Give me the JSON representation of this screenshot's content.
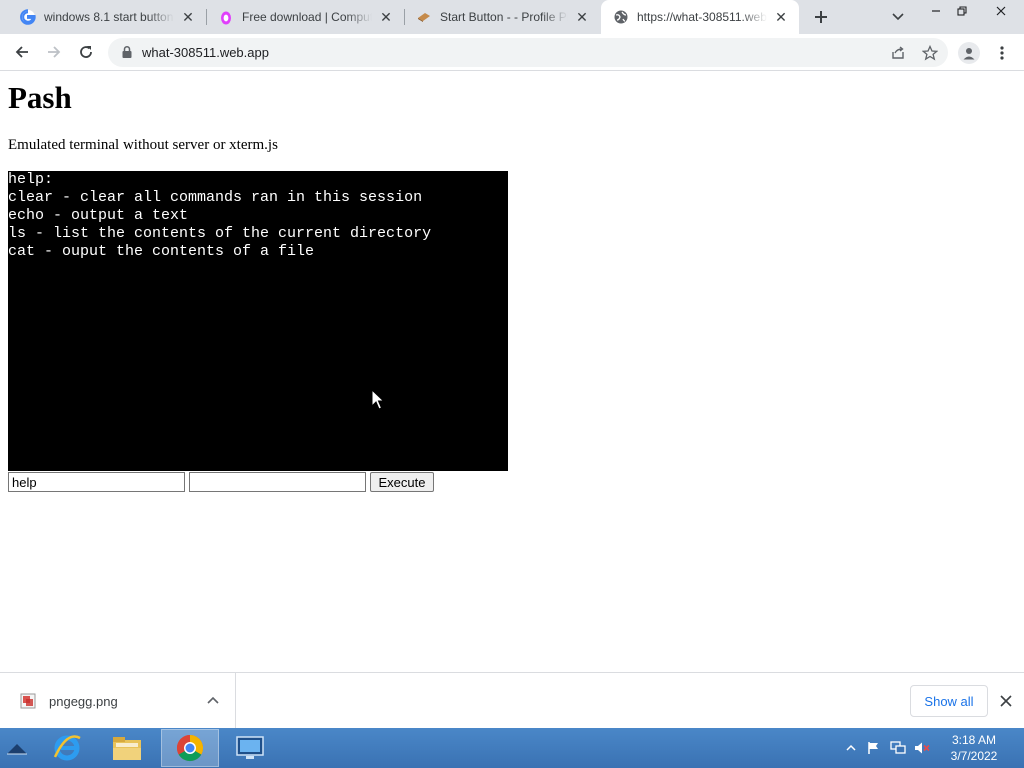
{
  "browser": {
    "tabs": [
      {
        "title": "windows 8.1 start button",
        "icon": "google-icon",
        "active": false
      },
      {
        "title": "Free download | Computer",
        "icon": "pngegg-icon",
        "active": false
      },
      {
        "title": "Start Button - - Profile Pi",
        "icon": "deviantart-icon",
        "active": false
      },
      {
        "title": "https://what-308511.web.",
        "icon": "globe-icon",
        "active": true
      }
    ],
    "address": "what-308511.web.app"
  },
  "page": {
    "title": "Pash",
    "subtitle": "Emulated terminal without server or xterm.js",
    "terminal_lines": [
      "help:",
      "clear - clear all commands ran in this session",
      "echo - output a text",
      "ls - list the contents of the current directory",
      "cat - ouput the contents of a file"
    ],
    "command_value": "help",
    "args_value": "",
    "execute_label": "Execute"
  },
  "downloads": {
    "file_name": "pngegg.png",
    "show_all_label": "Show all"
  },
  "taskbar": {
    "time": "3:18 AM",
    "date": "3/7/2022"
  }
}
